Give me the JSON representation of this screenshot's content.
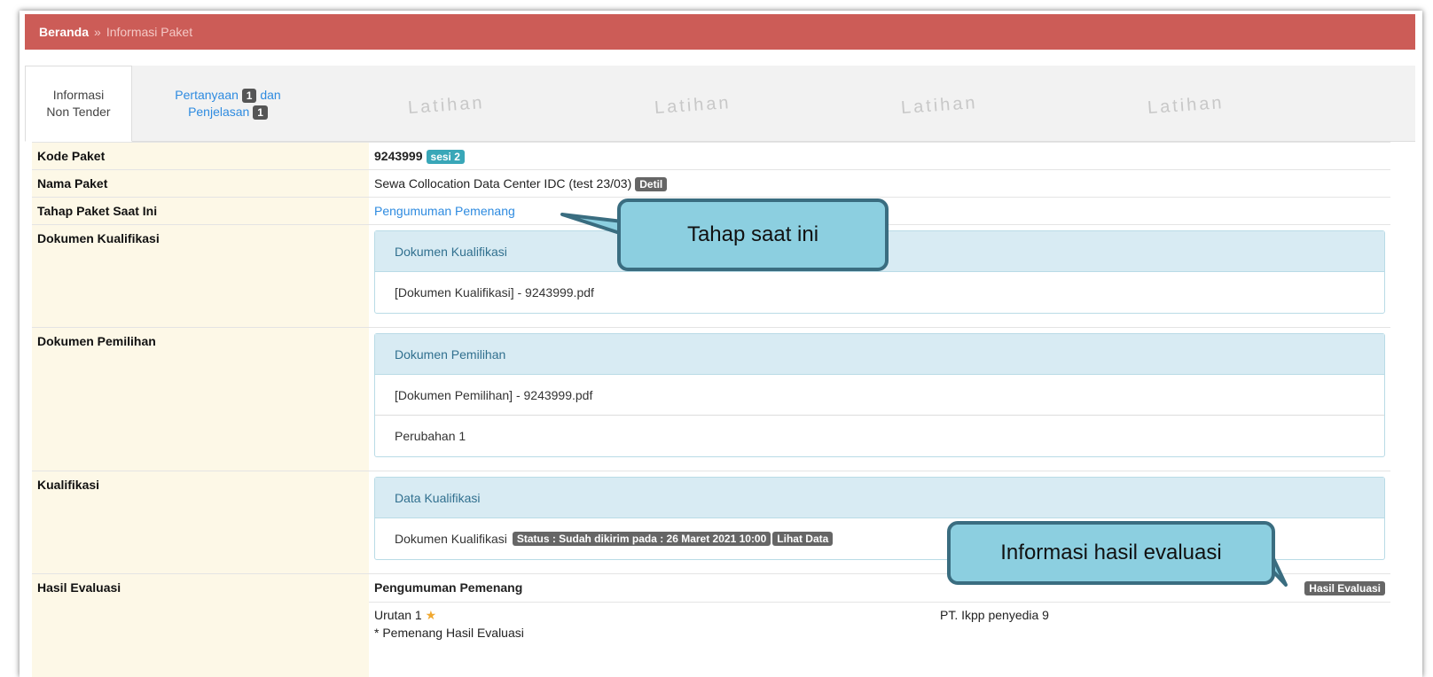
{
  "breadcrumb": {
    "home": "Beranda",
    "separator": "»",
    "current": "Informasi Paket"
  },
  "tabs": {
    "active": {
      "line1": "Informasi",
      "line2": "Non Tender"
    },
    "questions": {
      "pre": "Pertanyaan",
      "count1": "1",
      "mid": "dan",
      "post": "Penjelasan",
      "count2": "1"
    }
  },
  "watermark": "Latihan",
  "rows": {
    "kode": {
      "label": "Kode Paket",
      "value": "9243999",
      "badge": "sesi 2"
    },
    "nama": {
      "label": "Nama Paket",
      "value": "Sewa Collocation Data Center IDC (test 23/03)",
      "badge": "Detil"
    },
    "tahap": {
      "label": "Tahap Paket Saat Ini",
      "value": "Pengumuman Pemenang"
    },
    "dok_kualifikasi": {
      "label": "Dokumen Kualifikasi",
      "panel_title": "Dokumen Kualifikasi",
      "file": "[Dokumen Kualifikasi] - 9243999.pdf"
    },
    "dok_pemilihan": {
      "label": "Dokumen Pemilihan",
      "panel_title": "Dokumen Pemilihan",
      "file": "[Dokumen Pemilihan] - 9243999.pdf",
      "revision": "Perubahan 1"
    },
    "kualifikasi": {
      "label": "Kualifikasi",
      "panel_title": "Data Kualifikasi",
      "item_label": "Dokumen Kualifikasi",
      "status": "Status : Sudah dikirim pada : 26 Maret 2021 10:00",
      "view_button": "Lihat Data"
    },
    "hasil": {
      "label": "Hasil Evaluasi",
      "title": "Pengumuman Pemenang",
      "button": "Hasil Evaluasi",
      "rank": "Urutan 1",
      "note": "* Pemenang Hasil Evaluasi",
      "vendor": "PT. Ikpp penyedia 9"
    }
  },
  "callouts": {
    "tahap": "Tahap saat ini",
    "hasil": "Informasi hasil evaluasi"
  },
  "colors": {
    "header": "#cc5c57",
    "label_bg": "#fdf8e7",
    "panel_header": "#d8ebf3",
    "callout_fill": "#8ccfe0",
    "callout_border": "#3a6d80",
    "link": "#2e8be0"
  }
}
